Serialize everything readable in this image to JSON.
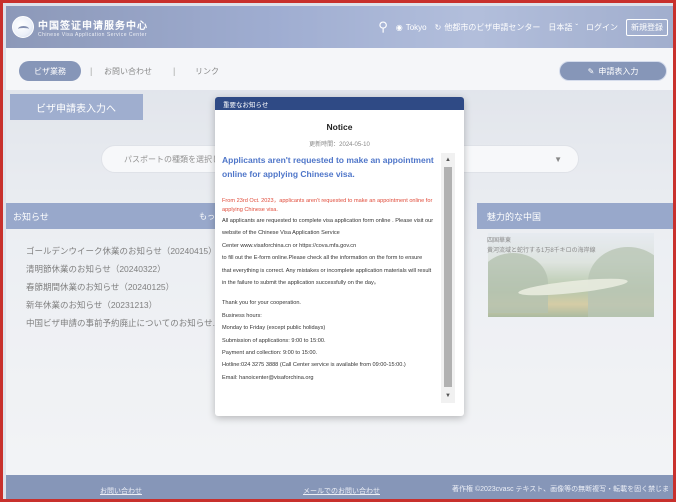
{
  "header": {
    "logo_cn": "中国签证申请服务中心",
    "logo_en": "Chinese Visa Application Service Center",
    "location": "Tokyo",
    "center_switch": "他都市のビザ申請センター",
    "language": "日本語",
    "login": "ログイン",
    "register": "新規登録"
  },
  "nav": {
    "visa_services": "ビザ業務",
    "contact": "お問い合わせ",
    "links": "リンク",
    "apply_button": "申請表入力"
  },
  "main": {
    "visa_tab": "ビザ申請表入力へ",
    "passport_placeholder": "パスポートの種類を選択し",
    "news_header": "お知らせ",
    "news_more": "もっ",
    "news_items": [
      "ゴールデンウイーク休業のお知らせ（20240415）",
      "清明節休業のお知らせ（20240322）",
      "春節期間休業のお知らせ（20240125）",
      "新年休業のお知らせ（20231213）",
      "中国ビザ申請の事前予約廃止についてのお知らせ..."
    ],
    "china_header": "魅力的な中国",
    "china_caption1": "四国華東",
    "china_caption2": "黄河流域と蛇行する1万8千キロの海岸線"
  },
  "modal": {
    "header": "重要なお知らせ",
    "title": "Notice",
    "date": "更新時間：2024-05-10",
    "heading": "Applicants aren't requested to make an appointment online for applying Chinese visa.",
    "red_text": "From 23rd Oct. 2023，applicants aren't requested to make an appointment online for applying Chinese visa.",
    "lines": [
      "All applicants are requested to complete visa application form online . Please visit our",
      "website of the Chinese Visa Application Service",
      "Center www.visaforchina.cn or https://cova.mfa.gov.cn",
      " to fill out the E-form online.Please check all the information on the form to ensure",
      "that everything is correct. Any mistakes or incomplete application materials will result",
      "in the failure to submit the application successfully on the day。"
    ],
    "lines2": [
      "Thank you for your cooperation.",
      "Business hours:",
      "Monday to Friday  (except public holidays)",
      "Submission of applications: 9:00 to 15:00.",
      "Payment and collection: 9:00 to 15:00.",
      "Hotline:024 3275 3888  (Call Center service is available from 09:00-15:00.)",
      "Email: hanoicenter@visaforchina.org"
    ]
  },
  "footer": {
    "contact": "お問い合わせ",
    "mail_contact": "メールでのお問い合わせ",
    "copyright": "著作権 ©2023cvasc  テキスト、画像等の無断複写・転載を固く禁じます"
  },
  "colors": {
    "brand": "#2f4a85",
    "accent_heading": "#4f76c9",
    "alert_red": "#e04b3a",
    "frame_border": "#c8302c"
  }
}
